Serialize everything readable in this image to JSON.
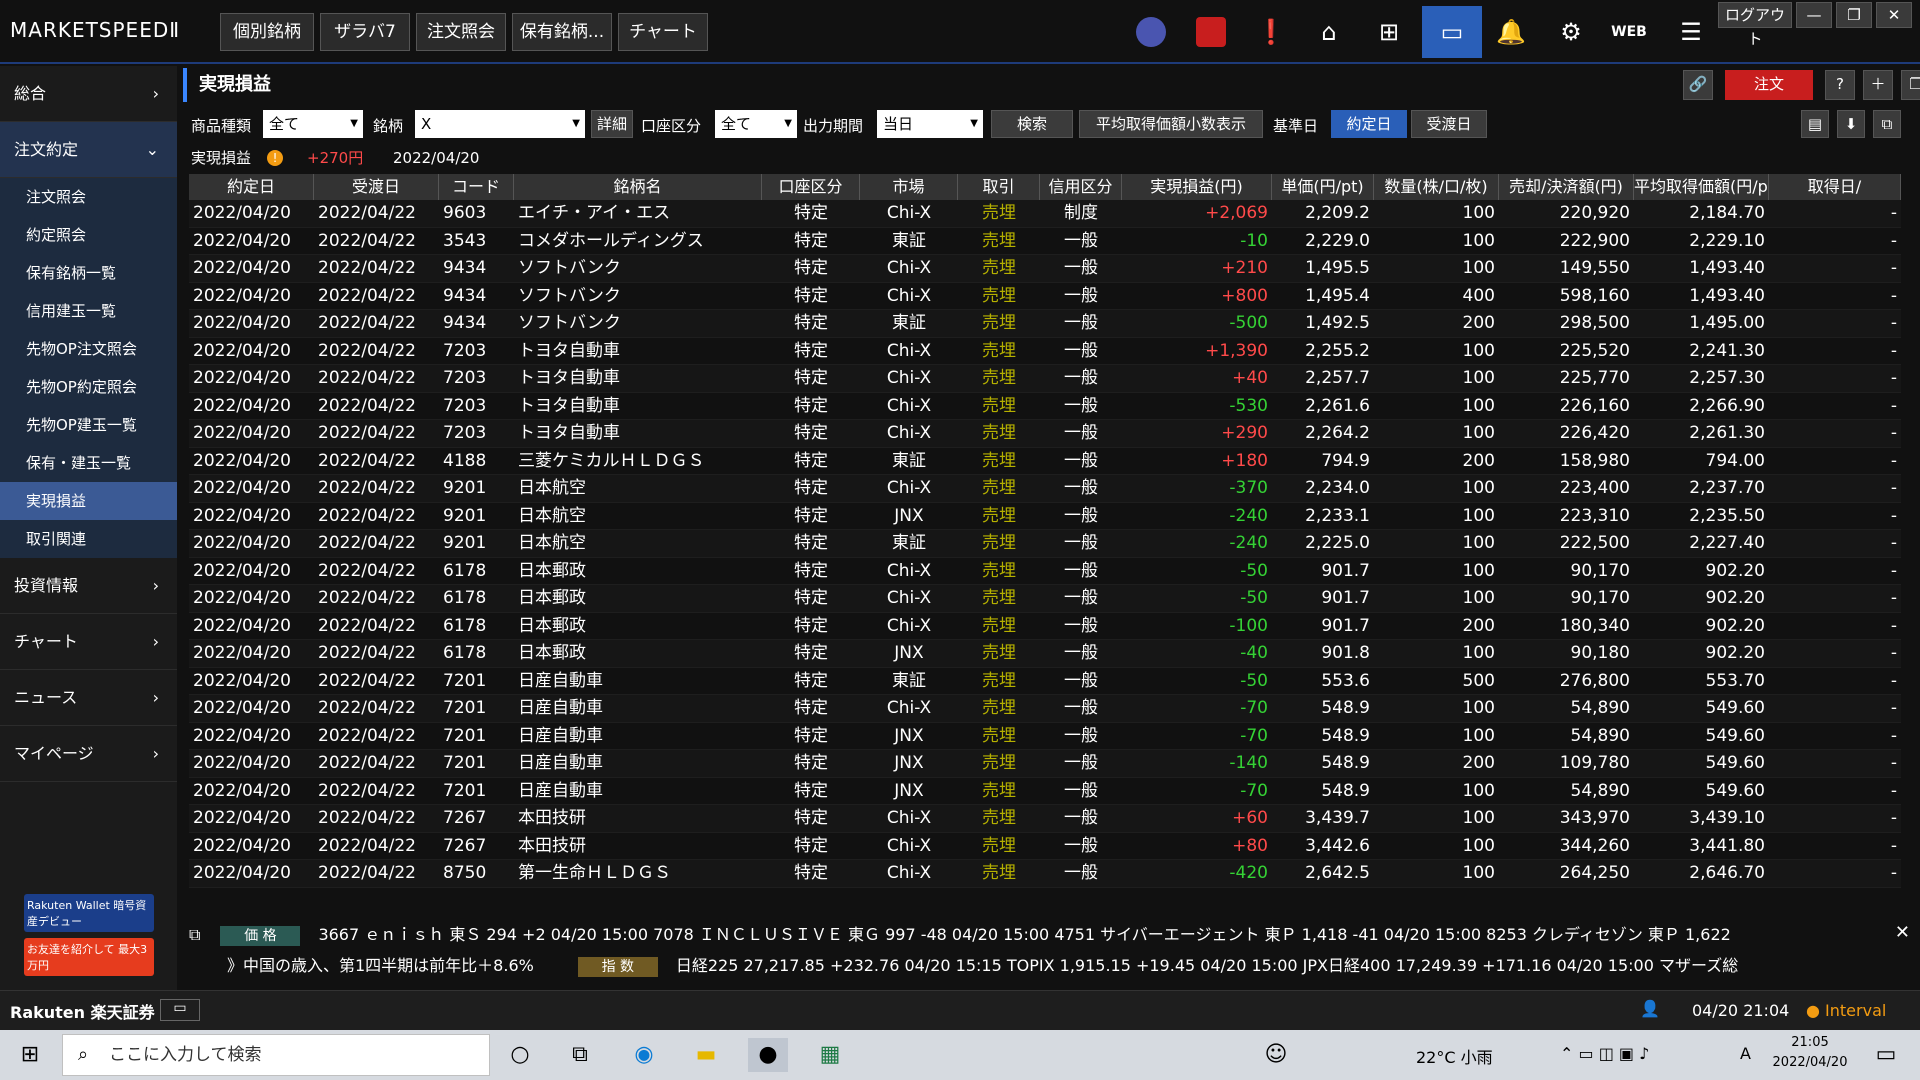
{
  "app": {
    "logo": "MARKETSPEEDⅡ",
    "tabs": [
      "個別銘柄",
      "ザラバ7",
      "注文照会",
      "保有銘柄...",
      "チャート"
    ],
    "logout": "ログアウト",
    "web": "WEB"
  },
  "sidebar": {
    "groups_top": [
      {
        "label": "総合",
        "icon": "chevron-right-icon"
      },
      {
        "label": "注文約定",
        "icon": "chevron-down-icon"
      }
    ],
    "items": [
      "注文照会",
      "約定照会",
      "保有銘柄一覧",
      "信用建玉一覧",
      "先物OP注文照会",
      "先物OP約定照会",
      "先物OP建玉一覧",
      "保有・建玉一覧",
      "実現損益",
      "取引関連"
    ],
    "groups_bottom": [
      "投資情報",
      "チャート",
      "ニュース",
      "マイページ"
    ],
    "banner1": "Rakuten Wallet 暗号資産デビュー",
    "banner2": "お友達を紹介して 最大3万円"
  },
  "page": {
    "title": "実現損益",
    "order_btn": "注文",
    "filters": {
      "product_label": "商品種類",
      "product_value": "全て",
      "symbol_label": "銘柄",
      "symbol_value": "X",
      "detail_btn": "詳細",
      "account_label": "口座区分",
      "account_value": "全て",
      "period_label": "出力期間",
      "period_value": "当日",
      "search_btn": "検索",
      "avg_btn": "平均取得価額小数表示",
      "base_label": "基準日",
      "base_opt1": "約定日",
      "base_opt2": "受渡日"
    },
    "summary": {
      "label": "実現損益",
      "value": "+270円",
      "date": "2022/04/20"
    }
  },
  "table": {
    "headers": [
      "約定日",
      "受渡日",
      "コード",
      "銘柄名",
      "口座区分",
      "市場",
      "取引",
      "信用区分",
      "実現損益(円)",
      "単価(円/pt)",
      "数量(株/口/枚)",
      "売却/決済額(円)",
      "平均取得価額(円/pt)",
      "取得日/"
    ],
    "rows": [
      [
        "2022/04/20",
        "2022/04/22",
        "9603",
        "エイチ・アイ・エス",
        "特定",
        "Chi-X",
        "売埋",
        "制度",
        "+2,069",
        "2,209.2",
        "100",
        "220,920",
        "2,184.70",
        "-"
      ],
      [
        "2022/04/20",
        "2022/04/22",
        "3543",
        "コメダホールディングス",
        "特定",
        "東証",
        "売埋",
        "一般",
        "-10",
        "2,229.0",
        "100",
        "222,900",
        "2,229.10",
        "-"
      ],
      [
        "2022/04/20",
        "2022/04/22",
        "9434",
        "ソフトバンク",
        "特定",
        "Chi-X",
        "売埋",
        "一般",
        "+210",
        "1,495.5",
        "100",
        "149,550",
        "1,493.40",
        "-"
      ],
      [
        "2022/04/20",
        "2022/04/22",
        "9434",
        "ソフトバンク",
        "特定",
        "Chi-X",
        "売埋",
        "一般",
        "+800",
        "1,495.4",
        "400",
        "598,160",
        "1,493.40",
        "-"
      ],
      [
        "2022/04/20",
        "2022/04/22",
        "9434",
        "ソフトバンク",
        "特定",
        "東証",
        "売埋",
        "一般",
        "-500",
        "1,492.5",
        "200",
        "298,500",
        "1,495.00",
        "-"
      ],
      [
        "2022/04/20",
        "2022/04/22",
        "7203",
        "トヨタ自動車",
        "特定",
        "Chi-X",
        "売埋",
        "一般",
        "+1,390",
        "2,255.2",
        "100",
        "225,520",
        "2,241.30",
        "-"
      ],
      [
        "2022/04/20",
        "2022/04/22",
        "7203",
        "トヨタ自動車",
        "特定",
        "Chi-X",
        "売埋",
        "一般",
        "+40",
        "2,257.7",
        "100",
        "225,770",
        "2,257.30",
        "-"
      ],
      [
        "2022/04/20",
        "2022/04/22",
        "7203",
        "トヨタ自動車",
        "特定",
        "Chi-X",
        "売埋",
        "一般",
        "-530",
        "2,261.6",
        "100",
        "226,160",
        "2,266.90",
        "-"
      ],
      [
        "2022/04/20",
        "2022/04/22",
        "7203",
        "トヨタ自動車",
        "特定",
        "Chi-X",
        "売埋",
        "一般",
        "+290",
        "2,264.2",
        "100",
        "226,420",
        "2,261.30",
        "-"
      ],
      [
        "2022/04/20",
        "2022/04/22",
        "4188",
        "三菱ケミカルＨＬＤＧＳ",
        "特定",
        "東証",
        "売埋",
        "一般",
        "+180",
        "794.9",
        "200",
        "158,980",
        "794.00",
        "-"
      ],
      [
        "2022/04/20",
        "2022/04/22",
        "9201",
        "日本航空",
        "特定",
        "Chi-X",
        "売埋",
        "一般",
        "-370",
        "2,234.0",
        "100",
        "223,400",
        "2,237.70",
        "-"
      ],
      [
        "2022/04/20",
        "2022/04/22",
        "9201",
        "日本航空",
        "特定",
        "JNX",
        "売埋",
        "一般",
        "-240",
        "2,233.1",
        "100",
        "223,310",
        "2,235.50",
        "-"
      ],
      [
        "2022/04/20",
        "2022/04/22",
        "9201",
        "日本航空",
        "特定",
        "東証",
        "売埋",
        "一般",
        "-240",
        "2,225.0",
        "100",
        "222,500",
        "2,227.40",
        "-"
      ],
      [
        "2022/04/20",
        "2022/04/22",
        "6178",
        "日本郵政",
        "特定",
        "Chi-X",
        "売埋",
        "一般",
        "-50",
        "901.7",
        "100",
        "90,170",
        "902.20",
        "-"
      ],
      [
        "2022/04/20",
        "2022/04/22",
        "6178",
        "日本郵政",
        "特定",
        "Chi-X",
        "売埋",
        "一般",
        "-50",
        "901.7",
        "100",
        "90,170",
        "902.20",
        "-"
      ],
      [
        "2022/04/20",
        "2022/04/22",
        "6178",
        "日本郵政",
        "特定",
        "Chi-X",
        "売埋",
        "一般",
        "-100",
        "901.7",
        "200",
        "180,340",
        "902.20",
        "-"
      ],
      [
        "2022/04/20",
        "2022/04/22",
        "6178",
        "日本郵政",
        "特定",
        "JNX",
        "売埋",
        "一般",
        "-40",
        "901.8",
        "100",
        "90,180",
        "902.20",
        "-"
      ],
      [
        "2022/04/20",
        "2022/04/22",
        "7201",
        "日産自動車",
        "特定",
        "東証",
        "売埋",
        "一般",
        "-50",
        "553.6",
        "500",
        "276,800",
        "553.70",
        "-"
      ],
      [
        "2022/04/20",
        "2022/04/22",
        "7201",
        "日産自動車",
        "特定",
        "Chi-X",
        "売埋",
        "一般",
        "-70",
        "548.9",
        "100",
        "54,890",
        "549.60",
        "-"
      ],
      [
        "2022/04/20",
        "2022/04/22",
        "7201",
        "日産自動車",
        "特定",
        "JNX",
        "売埋",
        "一般",
        "-70",
        "548.9",
        "100",
        "54,890",
        "549.60",
        "-"
      ],
      [
        "2022/04/20",
        "2022/04/22",
        "7201",
        "日産自動車",
        "特定",
        "JNX",
        "売埋",
        "一般",
        "-140",
        "548.9",
        "200",
        "109,780",
        "549.60",
        "-"
      ],
      [
        "2022/04/20",
        "2022/04/22",
        "7201",
        "日産自動車",
        "特定",
        "JNX",
        "売埋",
        "一般",
        "-70",
        "548.9",
        "100",
        "54,890",
        "549.60",
        "-"
      ],
      [
        "2022/04/20",
        "2022/04/22",
        "7267",
        "本田技研",
        "特定",
        "Chi-X",
        "売埋",
        "一般",
        "+60",
        "3,439.7",
        "100",
        "343,970",
        "3,439.10",
        "-"
      ],
      [
        "2022/04/20",
        "2022/04/22",
        "7267",
        "本田技研",
        "特定",
        "Chi-X",
        "売埋",
        "一般",
        "+80",
        "3,442.6",
        "100",
        "344,260",
        "3,441.80",
        "-"
      ],
      [
        "2022/04/20",
        "2022/04/22",
        "8750",
        "第一生命ＨＬＤＧＳ",
        "特定",
        "Chi-X",
        "売埋",
        "一般",
        "-420",
        "2,642.5",
        "100",
        "264,250",
        "2,646.70",
        "-"
      ]
    ]
  },
  "ticker": {
    "tag1": "価 格",
    "line1": "3667 ｅｎｉｓｈ 東Ｓ 294 +2 04/20 15:00    7078 ＩＮＣＬＵＳＩＶＥ 東Ｇ 997 -48 04/20 15:00    4751 サイバーエージェント 東Ｐ 1,418 -41 04/20 15:00    8253 クレディセゾン 東Ｐ 1,622",
    "news": "》中国の歳入、第1四半期は前年比＋8.6%",
    "tag2": "指 数",
    "line2": "日経225 27,217.85 +232.76 04/20 15:15    TOPIX 1,915.15 +19.45 04/20 15:00    JPX日経400 17,249.39 +171.16 04/20 15:00    マザーズ総"
  },
  "status": {
    "brand": "Rakuten 楽天証券",
    "time": "04/20 21:04",
    "interval": "Interval"
  },
  "taskbar": {
    "search": "ここに入力して検索",
    "weather": "22°C 小雨",
    "ime": "A",
    "clock_time": "21:05",
    "clock_date": "2022/04/20"
  }
}
